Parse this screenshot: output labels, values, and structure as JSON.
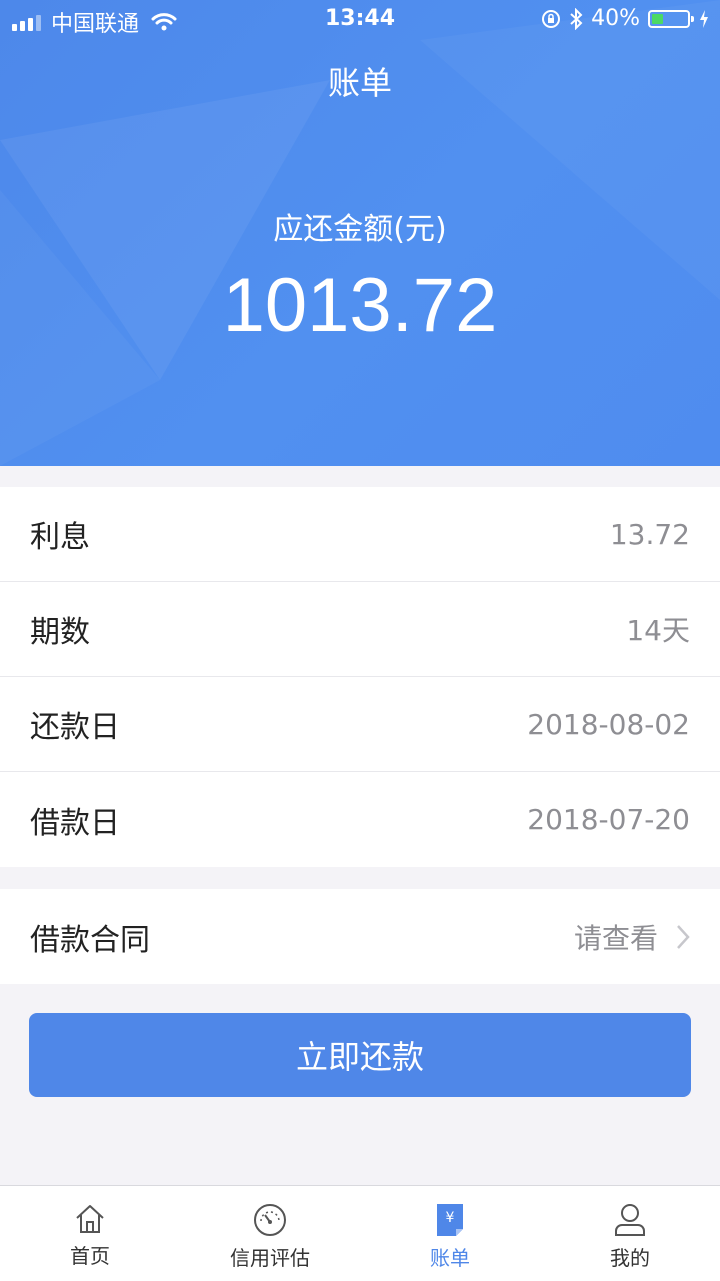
{
  "status_bar": {
    "carrier": "中国联通",
    "time": "13:44",
    "battery_percent": "40%",
    "battery_level": 0.4
  },
  "header": {
    "title": "账单",
    "amount_label": "应还金额(元)",
    "amount": "1013.72"
  },
  "details": [
    {
      "label": "利息",
      "value": "13.72"
    },
    {
      "label": "期数",
      "value": "14天"
    },
    {
      "label": "还款日",
      "value": "2018-08-02"
    },
    {
      "label": "借款日",
      "value": "2018-07-20"
    }
  ],
  "contract": {
    "label": "借款合同",
    "value": "请查看"
  },
  "pay_button": "立即还款",
  "tabs": [
    {
      "label": "首页",
      "icon": "home-icon",
      "active": false
    },
    {
      "label": "信用评估",
      "icon": "gauge-icon",
      "active": false
    },
    {
      "label": "账单",
      "icon": "bill-icon",
      "active": true
    },
    {
      "label": "我的",
      "icon": "user-icon",
      "active": false
    }
  ],
  "colors": {
    "accent": "#4f87e8",
    "header_bg": "#5190f0",
    "battery_fill": "#4cd964",
    "value_text": "#8e8e93"
  }
}
